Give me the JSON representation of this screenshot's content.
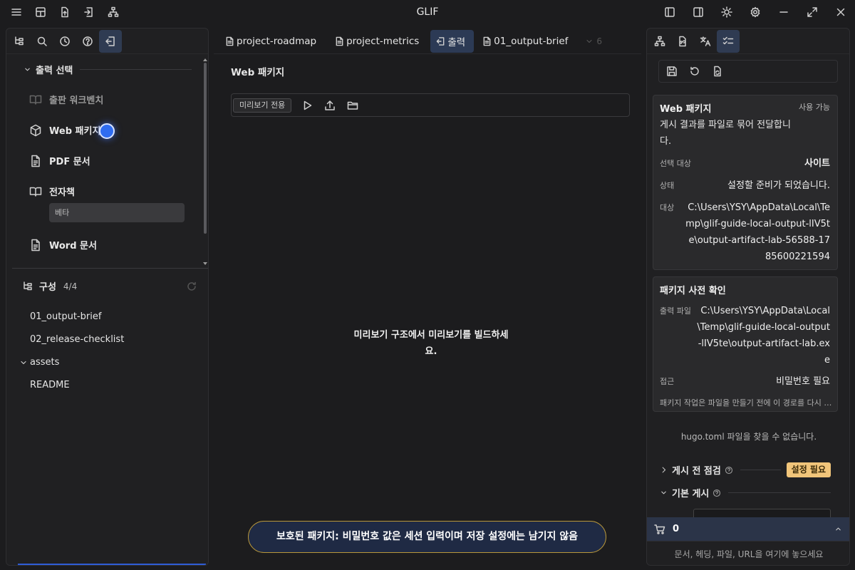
{
  "app": {
    "title": "GLIF"
  },
  "titlebar": {
    "left_icons": [
      "menu-icon",
      "layout-icon",
      "upload-file-icon",
      "export-icon",
      "hierarchy-icon"
    ],
    "right_icons": [
      "left-sidebar-icon",
      "right-sidebar-icon",
      "theme-icon",
      "settings-icon",
      "minimize-icon",
      "maximize-icon",
      "close-icon"
    ]
  },
  "left_panel": {
    "toolbar_icons": [
      "outline-icon",
      "search-icon",
      "history-icon",
      "help-icon",
      "output-icon"
    ],
    "output_section": {
      "title": "출력 선택",
      "items": [
        {
          "label": "출판 워크벤치",
          "icon": "book-open-icon",
          "disabled": true
        },
        {
          "label": "Web 패키지",
          "icon": "package-icon"
        },
        {
          "label": "PDF 문서",
          "icon": "document-icon"
        },
        {
          "label": "전자책",
          "icon": "book-icon",
          "badge": "베타"
        },
        {
          "label": "Word 문서",
          "icon": "document-icon"
        }
      ]
    },
    "composition": {
      "title": "구성",
      "count": "4/4",
      "items": [
        {
          "label": "01_output-brief",
          "type": "file"
        },
        {
          "label": "02_release-checklist",
          "type": "file"
        },
        {
          "label": "assets",
          "type": "folder"
        },
        {
          "label": "README",
          "type": "file"
        }
      ]
    }
  },
  "center": {
    "tabs": [
      {
        "label": "project-roadmap",
        "icon": "file-icon"
      },
      {
        "label": "project-metrics",
        "icon": "file-icon"
      },
      {
        "label": "출력",
        "icon": "output-icon",
        "active": true
      },
      {
        "label": "01_output-brief",
        "icon": "file-icon"
      }
    ],
    "tabs_more": "6",
    "title": "Web 패키지",
    "toolbar": {
      "chip": "미리보기 전용"
    },
    "message": "미리보기 구조에서 미리보기를 빌드하세요.",
    "toast": "보호된 패키지: 비밀번호 값은 세션 입력이며 저장 설정에는 남기지 않음"
  },
  "right_panel": {
    "toolbar_icons": [
      "hierarchy-icon",
      "file-link-icon",
      "translate-icon",
      "checklist-icon"
    ],
    "action_icons": [
      "save-icon",
      "refresh-icon",
      "file-sync-icon"
    ],
    "package_card": {
      "title": "Web 패키지",
      "status_badge": "사용 가능",
      "description": "게시 결과를 파일로 묶어 전달합니다.",
      "target_label": "선택 대상",
      "target_value": "사이트",
      "state_label": "상태",
      "state_value": "설정할 준비가 되었습니다.",
      "dest_label": "대상",
      "dest_value": "C:\\Users\\YSY\\AppData\\Local\\Temp\\glif-guide-local-output-lIV5te\\output-artifact-lab-56588-1785600221594"
    },
    "precheck_card": {
      "title": "패키지 사전 확인",
      "file_label": "출력 파일",
      "file_value": "C:\\Users\\YSY\\AppData\\Local\\Temp\\glif-guide-local-output-lIV5te\\output-artifact-lab.exe",
      "access_label": "접근",
      "access_value": "비밀번호 필요",
      "note": "패키지 작업은 파일을 만들기 전에 이 경로를 다시 확인합니다."
    },
    "hugo_message": "hugo.toml 파일을 찾을 수 없습니다.",
    "pre_publish": {
      "label": "게시 전 점검",
      "badge": "설정 필요"
    },
    "basic_publish": {
      "label": "기본 게시"
    },
    "cart": {
      "count": "0"
    },
    "drop_hint": "문서, 헤딩, 파일, URL을 여기에 놓으세요"
  },
  "colors": {
    "accent": "#2f6cf0",
    "active_tab": "#2c3a55",
    "warning_badge": "#f1c57a",
    "toast_border": "#b8973a"
  }
}
